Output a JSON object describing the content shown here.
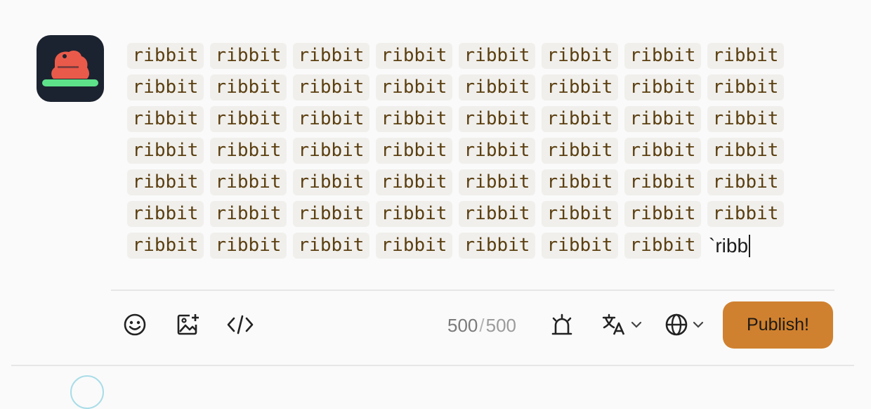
{
  "avatar": {
    "alt": "frog avatar",
    "bg": "#1c2330",
    "frog_color": "#ea5a4a",
    "pad_color": "#5de28a"
  },
  "editor": {
    "rows": [
      [
        "ribbit",
        "ribbit",
        "ribbit",
        "ribbit",
        "ribbit",
        "ribbit",
        "ribbit",
        "ribbit"
      ],
      [
        "ribbit",
        "ribbit",
        "ribbit",
        "ribbit",
        "ribbit",
        "ribbit",
        "ribbit",
        "ribbit"
      ],
      [
        "ribbit",
        "ribbit",
        "ribbit",
        "ribbit",
        "ribbit",
        "ribbit",
        "ribbit",
        "ribbit"
      ],
      [
        "ribbit",
        "ribbit",
        "ribbit",
        "ribbit",
        "ribbit",
        "ribbit",
        "ribbit",
        "ribbit"
      ],
      [
        "ribbit",
        "ribbit",
        "ribbit",
        "ribbit",
        "ribbit",
        "ribbit",
        "ribbit",
        "ribbit"
      ],
      [
        "ribbit",
        "ribbit",
        "ribbit",
        "ribbit",
        "ribbit",
        "ribbit",
        "ribbit",
        "ribbit"
      ],
      [
        "ribbit",
        "ribbit",
        "ribbit",
        "ribbit",
        "ribbit",
        "ribbit",
        "ribbit"
      ]
    ],
    "typing_text": "`ribb"
  },
  "toolbar": {
    "emoji_icon": "smiley-icon",
    "media_icon": "add-image-icon",
    "code_icon": "code-icon",
    "char_count": "500",
    "char_separator": "/",
    "char_max": "500",
    "alarm_icon": "alarm-icon",
    "language_icon": "translate-icon",
    "visibility_icon": "globe-icon",
    "publish_label": "Publish!",
    "publish_color": "#d0812f"
  }
}
